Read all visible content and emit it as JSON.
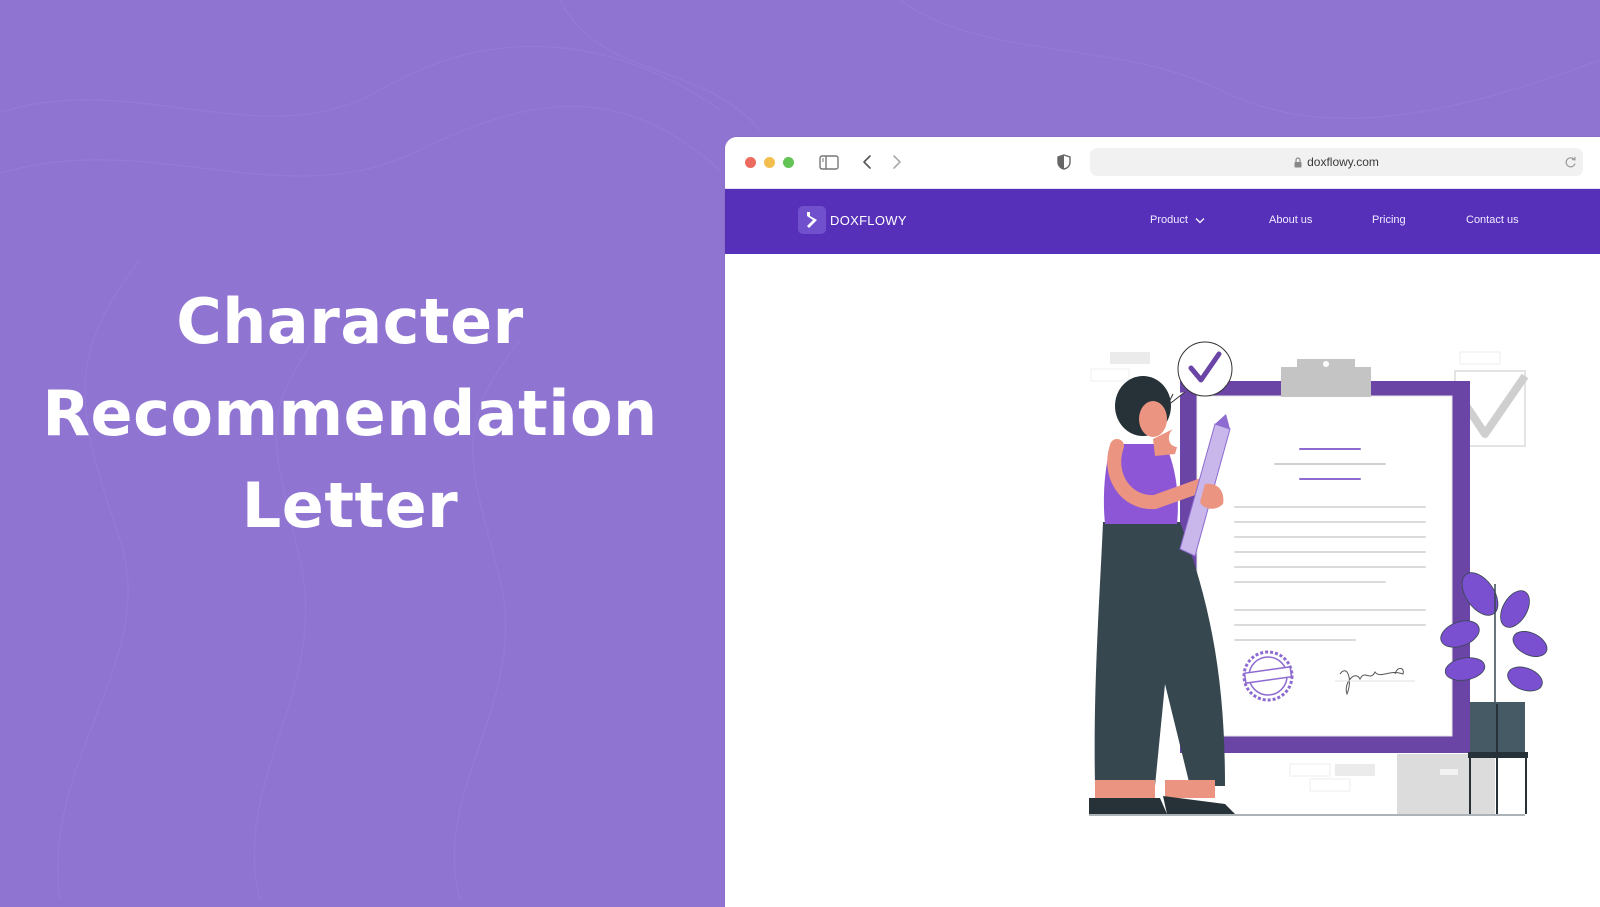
{
  "hero": {
    "title_lines": [
      "Character",
      "Recommendation",
      "Letter"
    ]
  },
  "browser": {
    "url": "doxflowy.com",
    "icons": {
      "sidebar": "sidebar-toggle-icon",
      "back": "chevron-left-icon",
      "forward": "chevron-right-icon",
      "privacy": "shield-icon",
      "lock": "lock-icon",
      "reload": "reload-icon"
    }
  },
  "site": {
    "brand": "DOXFLOWY",
    "nav": {
      "product": "Product",
      "about": "About us",
      "pricing": "Pricing",
      "contact": "Contact us"
    }
  },
  "colors": {
    "background": "#8f74d2",
    "nav": "#5730b9",
    "accent": "#6a45a6"
  }
}
